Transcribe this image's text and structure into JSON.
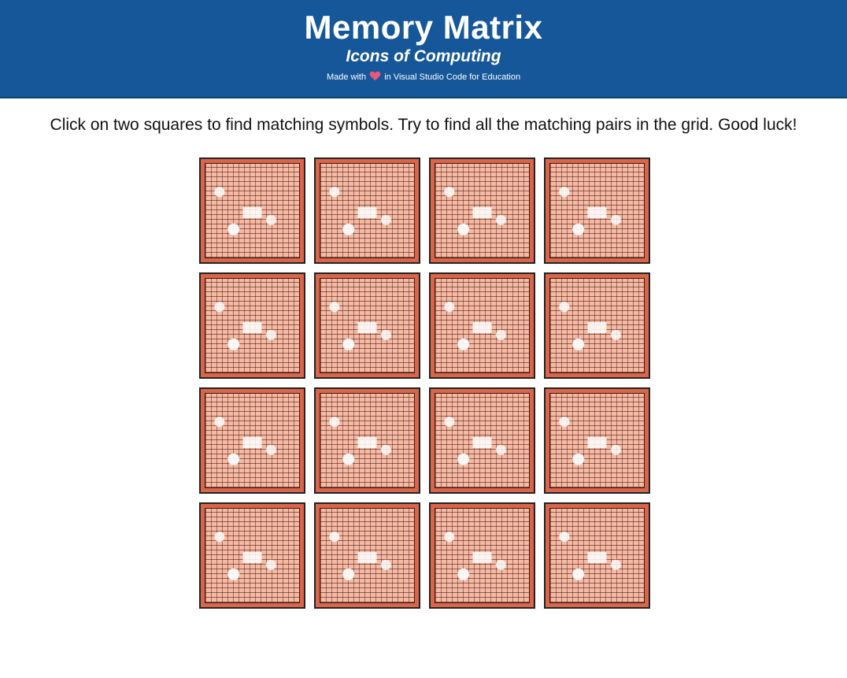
{
  "header": {
    "title": "Memory Matrix",
    "subtitle": "Icons of Computing",
    "credit_prefix": "Made with",
    "credit_suffix": "in Visual Studio Code for Education",
    "credit_icon": "heart-icon",
    "background_color": "#155799"
  },
  "instructions": "Click on two squares to find matching symbols. Try to find all the matching pairs in the grid. Good luck!",
  "board": {
    "rows": 4,
    "columns": 4,
    "card_back_color": "#d9654a",
    "cards": [
      {
        "state": "face-down"
      },
      {
        "state": "face-down"
      },
      {
        "state": "face-down"
      },
      {
        "state": "face-down"
      },
      {
        "state": "face-down"
      },
      {
        "state": "face-down"
      },
      {
        "state": "face-down"
      },
      {
        "state": "face-down"
      },
      {
        "state": "face-down"
      },
      {
        "state": "face-down"
      },
      {
        "state": "face-down"
      },
      {
        "state": "face-down"
      },
      {
        "state": "face-down"
      },
      {
        "state": "face-down"
      },
      {
        "state": "face-down"
      },
      {
        "state": "face-down"
      }
    ]
  }
}
